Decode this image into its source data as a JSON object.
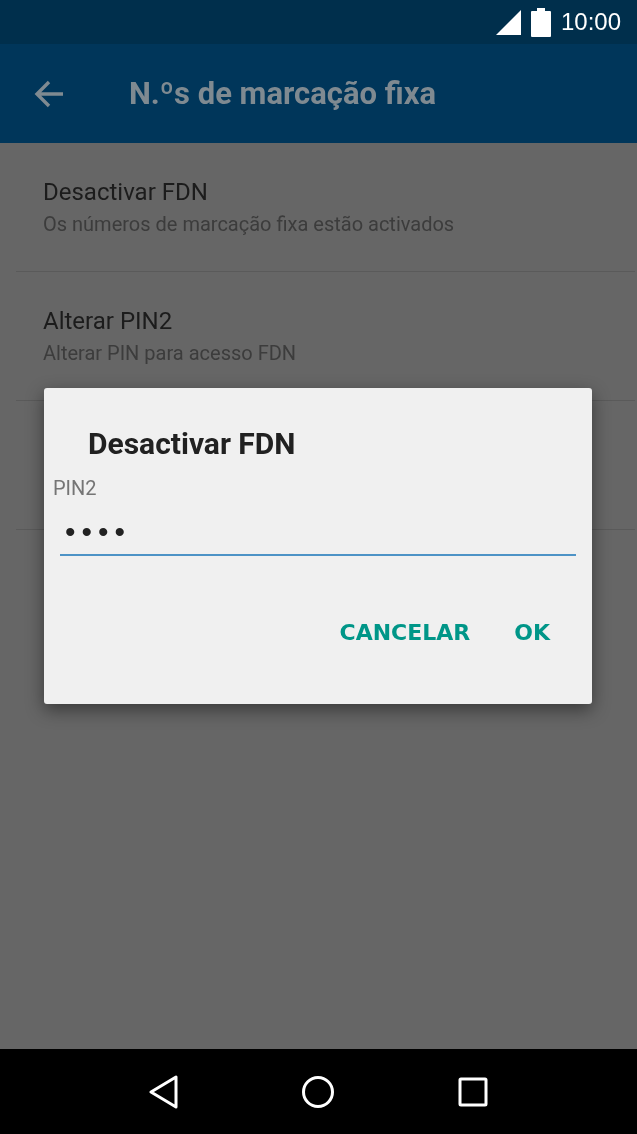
{
  "status_bar": {
    "time": "10:00"
  },
  "toolbar": {
    "title": "N.ºs de marcação fixa"
  },
  "preferences": [
    {
      "title": "Desactivar FDN",
      "summary": "Os números de marcação fixa estão activados"
    },
    {
      "title": "Alterar PIN2",
      "summary": "Alterar PIN para acesso FDN"
    }
  ],
  "dialog": {
    "title": "Desactivar FDN",
    "field": {
      "label": "PIN2",
      "value": "••••",
      "focused": true
    },
    "buttons": [
      {
        "label": "CANCELAR"
      },
      {
        "label": "OK"
      }
    ]
  }
}
